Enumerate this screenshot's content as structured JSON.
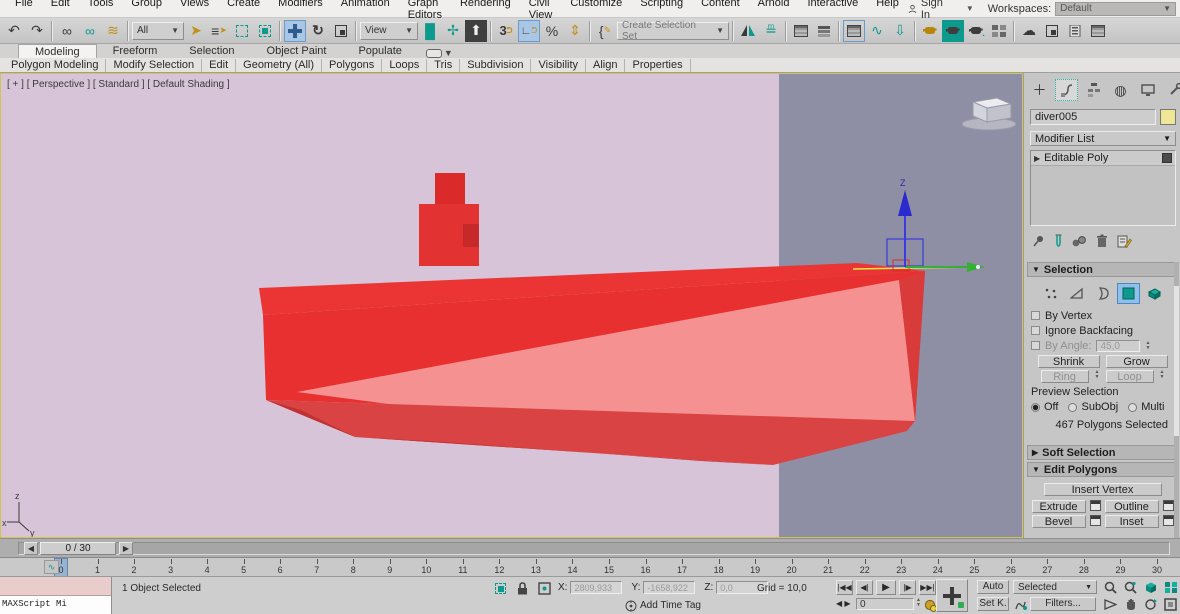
{
  "menu_bar": {
    "items": [
      "File",
      "Edit",
      "Tools",
      "Group",
      "Views",
      "Create",
      "Modifiers",
      "Animation",
      "Graph Editors",
      "Rendering",
      "Civil View",
      "Customize",
      "Scripting",
      "Content",
      "Arnold",
      "Interactive",
      "Help"
    ],
    "sign_in": "Sign In",
    "workspaces_label": "Workspaces:",
    "workspace_value": "Default"
  },
  "toolbar": {
    "selection_filter": "All",
    "ref_coord_system": "View",
    "snap_3_label": "3",
    "create_selection_set_label": "Create Selection Set"
  },
  "ribbon": {
    "tabs": [
      "Modeling",
      "Freeform",
      "Selection",
      "Object Paint",
      "Populate"
    ],
    "active_tab": "Modeling",
    "sections": [
      "Polygon Modeling",
      "Modify Selection",
      "Edit",
      "Geometry (All)",
      "Polygons",
      "Loops",
      "Tris",
      "Subdivision",
      "Visibility",
      "Align",
      "Properties"
    ]
  },
  "viewport": {
    "label": "[ + ] [ Perspective ] [ Standard ] [ Default Shading ]",
    "gizmo_axis_label": "Z",
    "axis_tripod": {
      "x": "x",
      "y": "y",
      "z": "z"
    },
    "colors": {
      "bg_left": "#d7c4d8",
      "bg_right": "#8e8ea4",
      "model_red": "#e93030",
      "model_salmon": "#f69191",
      "model_dark_red": "#c43434",
      "gizmo_yellow": "#e6e645",
      "gizmo_green": "#35b035",
      "gizmo_blue": "#3a3adf"
    }
  },
  "command_panel": {
    "object_name": "diver005",
    "modifier_list_label": "Modifier List",
    "stack_item": "Editable Poly",
    "selection": {
      "title": "Selection",
      "by_vertex": "By Vertex",
      "ignore_backfacing": "Ignore Backfacing",
      "by_angle": "By Angle:",
      "by_angle_value": "45,0",
      "shrink": "Shrink",
      "grow": "Grow",
      "ring": "Ring",
      "loop": "Loop",
      "preview_label": "Preview Selection",
      "preview_options": [
        "Off",
        "SubObj",
        "Multi"
      ],
      "preview_selected": "Off",
      "status": "467 Polygons Selected"
    },
    "soft_selection_title": "Soft Selection",
    "edit_polygons": {
      "title": "Edit Polygons",
      "insert_vertex": "Insert Vertex",
      "extrude": "Extrude",
      "outline": "Outline",
      "bevel": "Bevel",
      "inset": "Inset"
    }
  },
  "timeline": {
    "slider_label": "0 / 30",
    "frame_start": 0,
    "frame_end": 30,
    "current_frame": 0
  },
  "status_bar": {
    "maxscript_text": "MAXScript Mi",
    "selection_status": "1 Object Selected",
    "x_label": "X:",
    "x_value": "2809,933",
    "y_label": "Y:",
    "y_value": "-1658,922",
    "z_label": "Z:",
    "z_value": "0,0",
    "grid_text": "Grid = 10,0",
    "add_time_tag": "Add Time Tag",
    "frame_field": "0",
    "auto_label": "Auto",
    "selected_dropdown": "Selected",
    "set_key_label": "Set K.",
    "filters_label": "Filters..."
  }
}
